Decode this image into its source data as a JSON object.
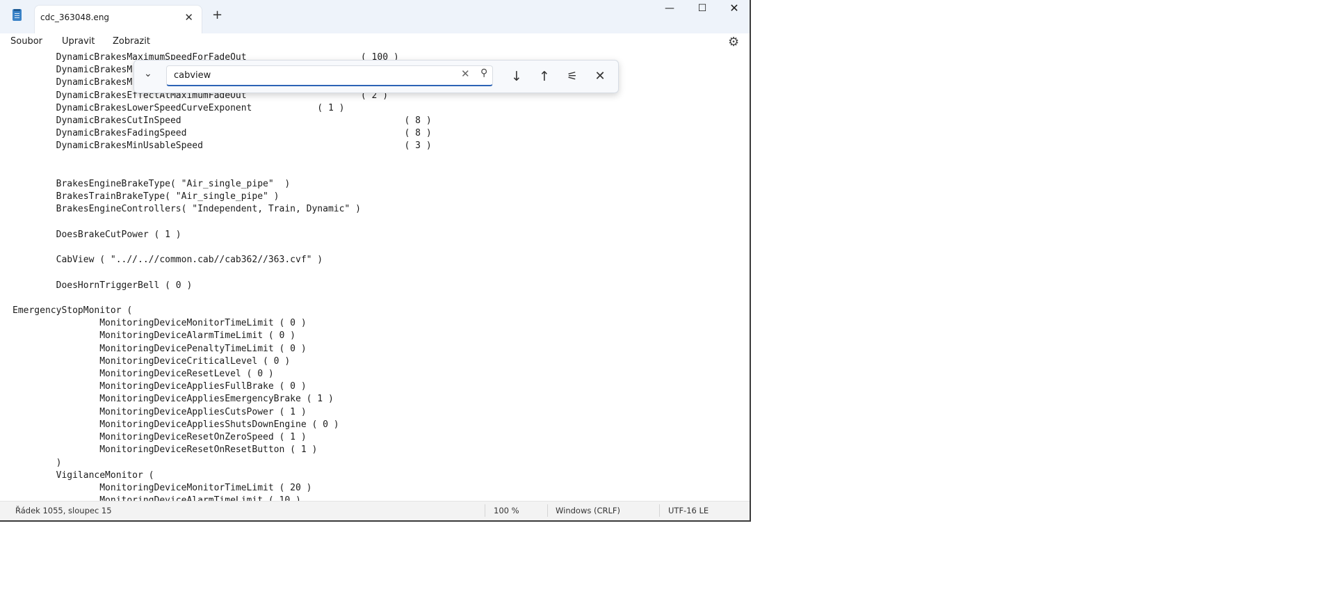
{
  "window": {
    "tab_title": "cdc_363048.eng",
    "icons": {
      "app": "notepad-icon",
      "tab_close": "close-icon",
      "new_tab": "plus-icon",
      "minimize": "minimize-icon",
      "maximize": "maximize-icon",
      "close": "close-icon"
    }
  },
  "menu": {
    "file": "Soubor",
    "edit": "Upravit",
    "view": "Zobrazit",
    "settings_icon": "gear-icon"
  },
  "find": {
    "value": "cabview",
    "icons": {
      "expand": "chevron-down-icon",
      "clear": "clear-icon",
      "search": "search-icon",
      "next": "arrow-down-icon",
      "previous": "arrow-up-icon",
      "options": "sliders-icon",
      "close": "close-icon"
    }
  },
  "editor": {
    "text": "        DynamicBrakesMaximumSpeedForFadeOut                     ( 100 )\n        DynamicBrakesM\n        DynamicBrakesM\n        DynamicBrakesEffectAtMaximumFadeOut                     ( 2 )\n        DynamicBrakesLowerSpeedCurveExponent            ( 1 )\n        DynamicBrakesCutInSpeed                                         ( 8 )\n        DynamicBrakesFadingSpeed                                        ( 8 )\n        DynamicBrakesMinUsableSpeed                                     ( 3 )\n\n\n        BrakesEngineBrakeType( \"Air_single_pipe\"  )\n        BrakesTrainBrakeType( \"Air_single_pipe\" )\n        BrakesEngineControllers( \"Independent, Train, Dynamic\" )\n\n        DoesBrakeCutPower ( 1 )\n\n        CabView ( \"..//..//common.cab//cab362//363.cvf\" )\n\n        DoesHornTriggerBell ( 0 )\n\nEmergencyStopMonitor (\n                MonitoringDeviceMonitorTimeLimit ( 0 )\n                MonitoringDeviceAlarmTimeLimit ( 0 )\n                MonitoringDevicePenaltyTimeLimit ( 0 )\n                MonitoringDeviceCriticalLevel ( 0 )\n                MonitoringDeviceResetLevel ( 0 )\n                MonitoringDeviceAppliesFullBrake ( 0 )\n                MonitoringDeviceAppliesEmergencyBrake ( 1 )\n                MonitoringDeviceAppliesCutsPower ( 1 )\n                MonitoringDeviceAppliesShutsDownEngine ( 0 )\n                MonitoringDeviceResetOnZeroSpeed ( 1 )\n                MonitoringDeviceResetOnResetButton ( 1 )\n        )\n        VigilanceMonitor (\n                MonitoringDeviceMonitorTimeLimit ( 20 )\n                MonitoringDeviceAlarmTimeLimit ( 10 )"
  },
  "status": {
    "position": "Řádek 1055, sloupec 15",
    "zoom": "100 %",
    "line_ending": "Windows (CRLF)",
    "encoding": "UTF-16 LE"
  }
}
